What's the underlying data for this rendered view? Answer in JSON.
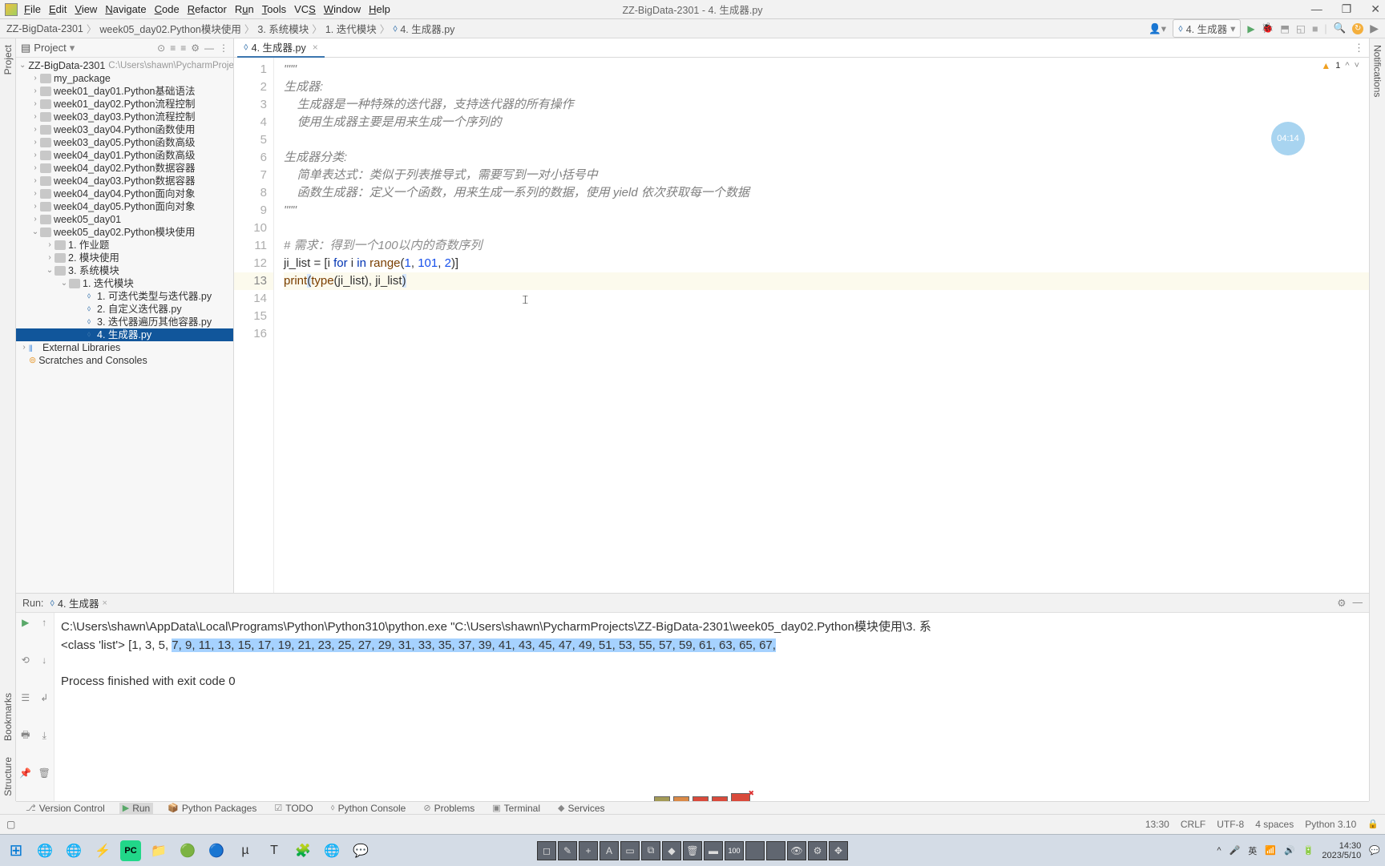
{
  "window_title": "ZZ-BigData-2301 - 4. 生成器.py",
  "menu": [
    "File",
    "Edit",
    "View",
    "Navigate",
    "Code",
    "Refactor",
    "Run",
    "Tools",
    "VCS",
    "Window",
    "Help"
  ],
  "menu_underline_idx": [
    0,
    0,
    0,
    0,
    0,
    0,
    0,
    0,
    2,
    0,
    0
  ],
  "breadcrumbs": [
    "ZZ-BigData-2301",
    "week05_day02.Python模块使用",
    "3. 系统模块",
    "1. 迭代模块",
    "4. 生成器.py"
  ],
  "run_config": {
    "name": "4. 生成器"
  },
  "nav_icons": {
    "user": "user-plus-icon"
  },
  "left_rail": {
    "top": "Project",
    "bottom": [
      "Bookmarks",
      "Structure"
    ]
  },
  "right_rail": {
    "top": "Notifications"
  },
  "project_header": {
    "title": "Project"
  },
  "tree": [
    {
      "lvl": 0,
      "caret": "v",
      "ico": "proj",
      "text": "ZZ-BigData-2301",
      "dim": "C:\\Users\\shawn\\PycharmProjects",
      "sel": false
    },
    {
      "lvl": 1,
      "caret": ">",
      "ico": "pkg",
      "text": "my_package"
    },
    {
      "lvl": 1,
      "caret": ">",
      "ico": "dir",
      "text": "week01_day01.Python基础语法"
    },
    {
      "lvl": 1,
      "caret": ">",
      "ico": "dir",
      "text": "week01_day02.Python流程控制"
    },
    {
      "lvl": 1,
      "caret": ">",
      "ico": "dir",
      "text": "week03_day03.Python流程控制"
    },
    {
      "lvl": 1,
      "caret": ">",
      "ico": "dir",
      "text": "week03_day04.Python函数使用"
    },
    {
      "lvl": 1,
      "caret": ">",
      "ico": "dir",
      "text": "week03_day05.Python函数高级"
    },
    {
      "lvl": 1,
      "caret": ">",
      "ico": "dir",
      "text": "week04_day01.Python函数高级"
    },
    {
      "lvl": 1,
      "caret": ">",
      "ico": "dir",
      "text": "week04_day02.Python数据容器"
    },
    {
      "lvl": 1,
      "caret": ">",
      "ico": "dir",
      "text": "week04_day03.Python数据容器"
    },
    {
      "lvl": 1,
      "caret": ">",
      "ico": "dir",
      "text": "week04_day04.Python面向对象"
    },
    {
      "lvl": 1,
      "caret": ">",
      "ico": "dir",
      "text": "week04_day05.Python面向对象"
    },
    {
      "lvl": 1,
      "caret": ">",
      "ico": "dir",
      "text": "week05_day01"
    },
    {
      "lvl": 1,
      "caret": "v",
      "ico": "dir",
      "text": "week05_day02.Python模块使用"
    },
    {
      "lvl": 2,
      "caret": ">",
      "ico": "dir",
      "text": "1. 作业题"
    },
    {
      "lvl": 2,
      "caret": ">",
      "ico": "dir",
      "text": "2. 模块使用"
    },
    {
      "lvl": 2,
      "caret": "v",
      "ico": "dir",
      "text": "3. 系统模块"
    },
    {
      "lvl": 3,
      "caret": "v",
      "ico": "dir",
      "text": "1. 迭代模块"
    },
    {
      "lvl": 4,
      "caret": " ",
      "ico": "py",
      "text": "1. 可迭代类型与迭代器.py"
    },
    {
      "lvl": 4,
      "caret": " ",
      "ico": "py",
      "text": "2. 自定义迭代器.py"
    },
    {
      "lvl": 4,
      "caret": " ",
      "ico": "py",
      "text": "3. 迭代器遍历其他容器.py"
    },
    {
      "lvl": 4,
      "caret": " ",
      "ico": "py",
      "text": "4. 生成器.py",
      "sel": true
    },
    {
      "lvl": 0,
      "caret": ">",
      "ico": "lib",
      "text": "External Libraries"
    },
    {
      "lvl": 0,
      "caret": " ",
      "ico": "scratch",
      "text": "Scratches and Consoles"
    }
  ],
  "editor_tab": {
    "name": "4. 生成器.py"
  },
  "warnings": {
    "count": "1"
  },
  "timer_badge": "04:14",
  "code_lines": {
    "1": {
      "type": "doc",
      "text": "\"\"\""
    },
    "2": {
      "type": "doc",
      "text": "生成器:"
    },
    "3": {
      "type": "doc",
      "text": "    生成器是一种特殊的迭代器，支持迭代器的所有操作"
    },
    "4": {
      "type": "doc",
      "text": "    使用生成器主要是用来生成一个序列的"
    },
    "5": {
      "type": "blank",
      "text": ""
    },
    "6": {
      "type": "doc",
      "text": "生成器分类:"
    },
    "7": {
      "type": "doc",
      "text": "    简单表达式：类似于列表推导式，需要写到一对小括号中"
    },
    "8": {
      "type": "doc",
      "text": "    函数生成器：定义一个函数，用来生成一系列的数据，使用 yield 依次获取每一个数据"
    },
    "9": {
      "type": "doc",
      "text": "\"\"\""
    },
    "10": {
      "type": "blank",
      "text": ""
    },
    "11": {
      "type": "comment",
      "text": "# 需求：得到一个100以内的奇数序列"
    },
    "12": {
      "type": "code",
      "seg": [
        "ji_list = [i ",
        "for",
        " i ",
        "in",
        " ",
        "range",
        "(",
        "1",
        ", ",
        "101",
        ", ",
        "2",
        ")]"
      ]
    },
    "13": {
      "type": "code_hl",
      "seg": [
        "print",
        "(",
        "type",
        "(ji_list), ji_list",
        ")"
      ]
    },
    "14": {
      "type": "blank",
      "text": ""
    },
    "15": {
      "type": "blank",
      "text": ""
    },
    "16": {
      "type": "blank",
      "text": ""
    }
  },
  "run_panel": {
    "title": "Run:",
    "tab": "4. 生成器",
    "line1": "C:\\Users\\shawn\\AppData\\Local\\Programs\\Python\\Python310\\python.exe \"C:\\Users\\shawn\\PycharmProjects\\ZZ-BigData-2301\\week05_day02.Python模块使用\\3. 系",
    "line2_a": "<class 'list'> [1, 3, 5, ",
    "line2_b": "7, 9, 11, 13, 15, 17, 19, 21, 23, 25, 27, 29, 31, 33, 35, 37, 39, 41, 43, 45, 47, 49, 51, 53, 55, 57, 59, 61, 63, 65, 67,",
    "line3": "",
    "line4": "Process finished with exit code 0"
  },
  "tool_tabs": [
    "Version Control",
    "Run",
    "Python Packages",
    "TODO",
    "Python Console",
    "Problems",
    "Terminal",
    "Services"
  ],
  "tool_tab_active_idx": 1,
  "status": {
    "cursor": "13:30",
    "crlf": "CRLF",
    "enc": "UTF-8",
    "indent": "4 spaces",
    "sdk": "Python 3.10"
  },
  "taskbar_time": {
    "time": "14:30",
    "date": "2023/5/10"
  },
  "tray_lang": "英"
}
